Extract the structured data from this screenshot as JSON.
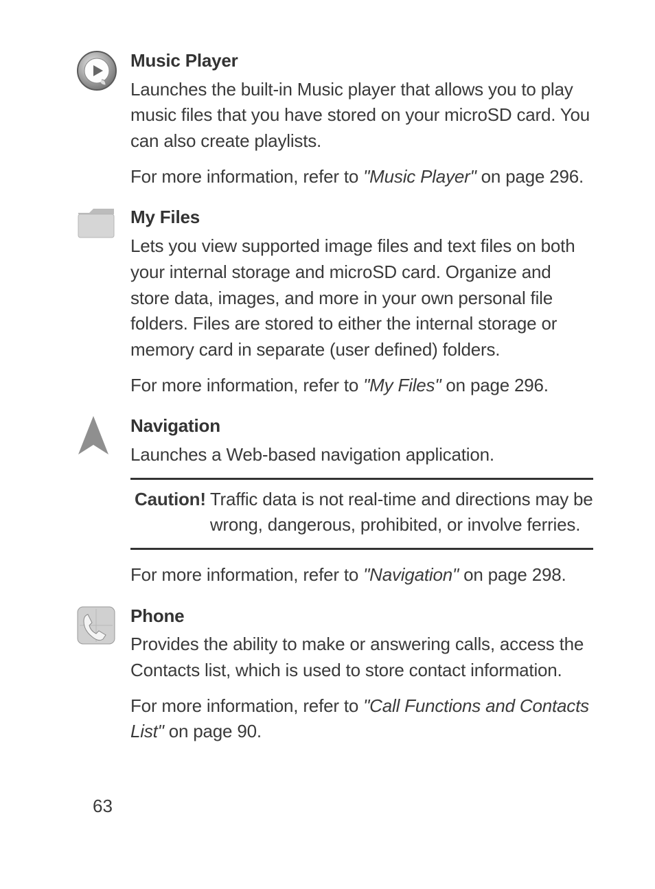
{
  "pageNumber": "63",
  "entries": {
    "musicPlayer": {
      "title": "Music Player",
      "body": "Launches the built-in Music player that allows you to play music files that you have stored on your microSD card. You can also create playlists.",
      "refPrefix": "For more information, refer to ",
      "refItalic": "\"Music Player\"",
      "refSuffix": "  on page 296."
    },
    "myFiles": {
      "title": "My Files",
      "body": "Lets you view supported image files and text files on both your internal storage and microSD card. Organize and store data, images, and more in your own personal file folders. Files are stored to either the internal storage or memory card in separate (user defined) folders.",
      "refPrefix": "For more information, refer to ",
      "refItalic": "\"My Files\"",
      "refSuffix": "  on page 296."
    },
    "navigation": {
      "title": "Navigation",
      "body": "Launches a Web-based navigation application.",
      "cautionLabel": "Caution!",
      "cautionText": "Traffic data is not real-time and directions may be wrong, dangerous, prohibited, or involve ferries.",
      "refPrefix": "For more information, refer to ",
      "refItalic": "\"Navigation\"",
      "refSuffix": "  on page 298."
    },
    "phone": {
      "title": "Phone",
      "body": "Provides the ability to make or answering calls, access the Contacts list, which is used to store contact information.",
      "refPrefix": "For more information, refer to ",
      "refItalic": "\"Call Functions and Contacts List\"",
      "refSuffix": "  on page 90."
    }
  }
}
